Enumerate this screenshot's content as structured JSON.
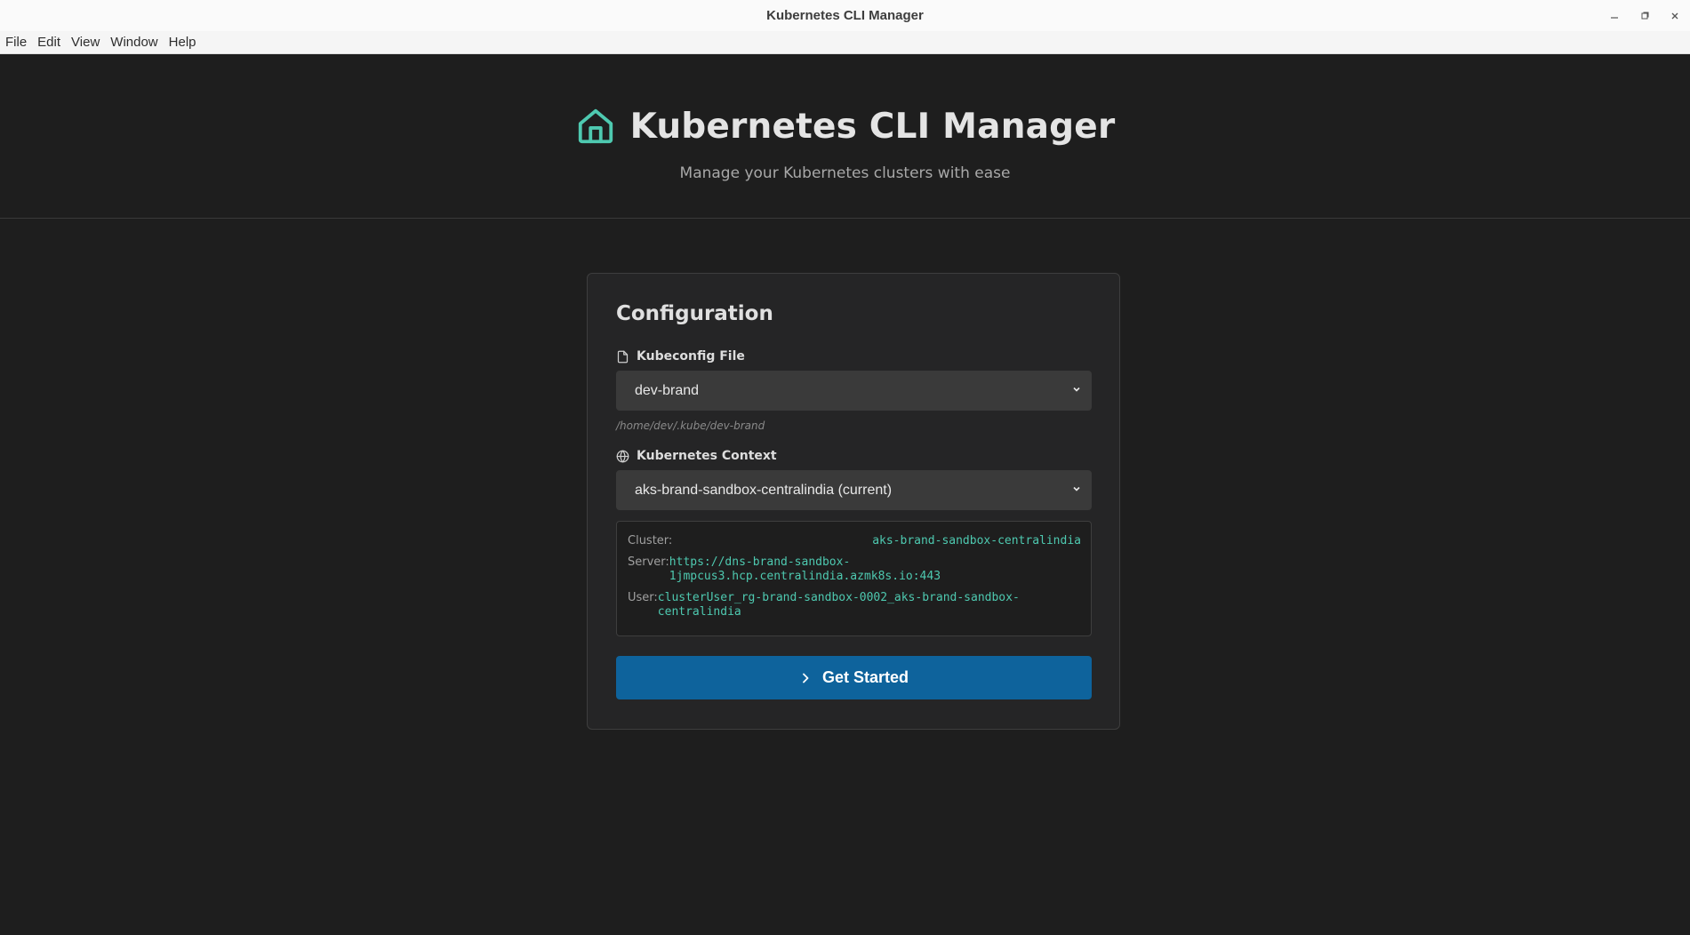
{
  "window": {
    "title": "Kubernetes CLI Manager",
    "controls": [
      "minimize",
      "maximize",
      "close"
    ]
  },
  "menubar": {
    "items": [
      "File",
      "Edit",
      "View",
      "Window",
      "Help"
    ]
  },
  "header": {
    "icon": "home-icon",
    "title": "Kubernetes CLI Manager",
    "subtitle": "Manage your Kubernetes clusters with ease"
  },
  "config": {
    "title": "Configuration",
    "kubeconfig": {
      "label": "Kubeconfig File",
      "icon": "file-icon",
      "selected": "dev-brand",
      "path": "/home/dev/.kube/dev-brand"
    },
    "context": {
      "label": "Kubernetes Context",
      "icon": "globe-icon",
      "selected": "aks-brand-sandbox-centralindia (current)"
    },
    "details": {
      "cluster_label": "Cluster:",
      "cluster_value": "aks-brand-sandbox-centralindia",
      "server_label": "Server:",
      "server_value_line1": "https://dns-brand-sandbox-",
      "server_value_line2": "1jmpcus3.hcp.centralindia.azmk8s.io:443",
      "user_label": "User:",
      "user_value_line1": "clusterUser_rg-brand-sandbox-0002_aks-brand-sandbox-",
      "user_value_line2": "centralindia"
    },
    "button": {
      "label": "Get Started",
      "icon": "chevron-right-icon"
    }
  },
  "colors": {
    "accent_teal": "#4ec9b0",
    "button_blue": "#0e639c",
    "background": "#1e1e1e",
    "card": "#252526"
  }
}
